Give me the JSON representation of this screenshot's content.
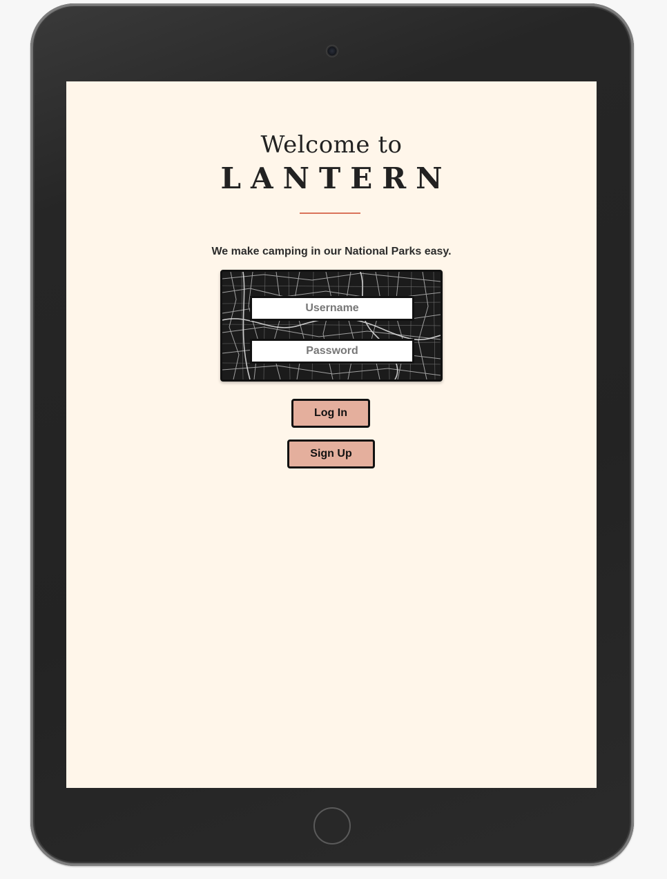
{
  "header": {
    "welcome": "Welcome to",
    "brand": "LANTERN"
  },
  "tagline": "We make camping in our National Parks easy.",
  "form": {
    "username_placeholder": "Username",
    "password_placeholder": "Password"
  },
  "buttons": {
    "login_label": "Log In",
    "signup_label": "Sign Up"
  },
  "colors": {
    "background": "#fff6ea",
    "accent": "#d9725a",
    "button": "#e4af9d"
  }
}
